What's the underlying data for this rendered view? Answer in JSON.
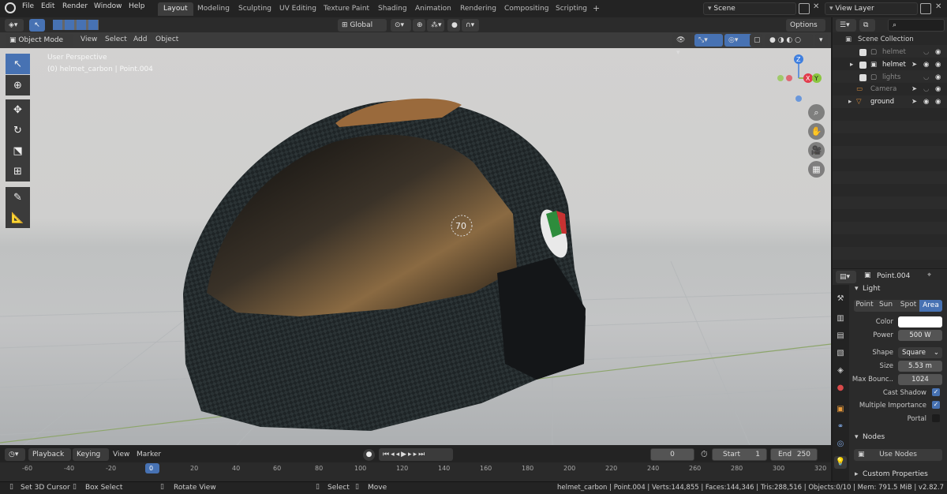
{
  "menubar": {
    "items": [
      "File",
      "Edit",
      "Render",
      "Window",
      "Help"
    ],
    "workspaces": [
      "Layout",
      "Modeling",
      "Sculpting",
      "UV Editing",
      "Texture Paint",
      "Shading",
      "Animation",
      "Rendering",
      "Compositing",
      "Scripting"
    ],
    "active_workspace": "Layout",
    "scene": "Scene",
    "view_layer": "View Layer"
  },
  "viewport_header": {
    "mode": "Object Mode",
    "menus": [
      "View",
      "Select",
      "Add",
      "Object"
    ],
    "transform_orientation": "Global",
    "options_label": "Options"
  },
  "viewport": {
    "perspective_label": "User Perspective",
    "object_info": "(0) helmet_carbon | Point.004",
    "gizmo_axes": [
      "Z",
      "X",
      "Y"
    ],
    "helmet_badge": "70",
    "colors": {
      "active_tool": "#4772b3",
      "x_axis": "#e23b4c",
      "y_axis": "#8bc63f",
      "z_axis": "#3f7fdf"
    }
  },
  "outliner": {
    "search_placeholder": "",
    "root": "Scene Collection",
    "items": [
      {
        "name": "helmet",
        "dimmed": true
      },
      {
        "name": "helmet",
        "dimmed": false
      },
      {
        "name": "lights",
        "dimmed": true
      },
      {
        "name": "Camera",
        "dimmed": true
      },
      {
        "name": "ground",
        "dimmed": false
      }
    ]
  },
  "properties": {
    "object_name": "Point.004",
    "section_light": "Light",
    "light_types": [
      "Point",
      "Sun",
      "Spot",
      "Area"
    ],
    "active_light_type": "Area",
    "fields": {
      "color_label": "Color",
      "power_label": "Power",
      "power": "500 W",
      "shape_label": "Shape",
      "shape": "Square",
      "size_label": "Size",
      "size": "5.53 m",
      "max_bounce_label": "Max Bounc..",
      "max_bounce": "1024",
      "cast_shadow": "Cast Shadow",
      "multiple_importance": "Multiple Importance",
      "portal": "Portal"
    },
    "section_nodes": "Nodes",
    "use_nodes": "Use Nodes",
    "section_custom": "Custom Properties"
  },
  "timeline": {
    "menus": [
      "Playback",
      "Keying",
      "View",
      "Marker"
    ],
    "current_frame": "0",
    "start_label": "Start",
    "start": "1",
    "end_label": "End",
    "end": "250",
    "ruler": [
      "-60",
      "-40",
      "-20",
      "0",
      "20",
      "40",
      "60",
      "80",
      "100",
      "120",
      "140",
      "160",
      "180",
      "200",
      "220",
      "240",
      "260",
      "280",
      "300",
      "320"
    ]
  },
  "statusbar": {
    "set_cursor": "Set 3D Cursor",
    "box_select": "Box Select",
    "rotate_view": "Rotate View",
    "select": "Select",
    "move": "Move",
    "stats": "helmet_carbon | Point.004 | Verts:144,855 | Faces:144,346 | Tris:288,516 | Objects:0/10 | Mem: 791.5 MiB | v2.82.7"
  }
}
